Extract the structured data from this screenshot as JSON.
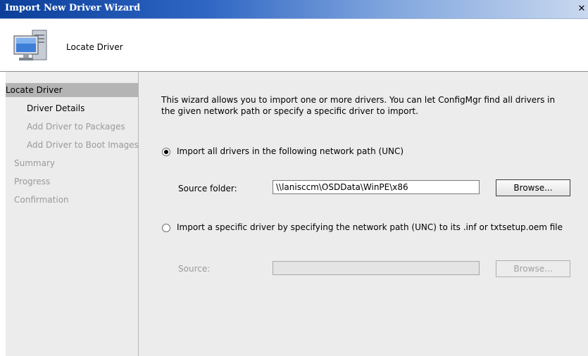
{
  "window": {
    "title": "Import New Driver Wizard",
    "close_glyph": "✕"
  },
  "header": {
    "title": "Locate Driver",
    "icon": "computer-icon"
  },
  "sidebar": {
    "items": [
      {
        "label": "Locate Driver",
        "state": "active"
      },
      {
        "label": "Driver Details",
        "state": "current"
      },
      {
        "label": "Add Driver to Packages",
        "state": "disabled"
      },
      {
        "label": "Add Driver to Boot Images",
        "state": "disabled"
      },
      {
        "label": "Summary",
        "state": "disabled"
      },
      {
        "label": "Progress",
        "state": "disabled"
      },
      {
        "label": "Confirmation",
        "state": "disabled"
      }
    ]
  },
  "main": {
    "description": "This wizard allows you to import one or more drivers. You can let ConfigMgr find all drivers in the given network path or specify a specific driver to import.",
    "option_all": {
      "label": "Import all drivers in the following network path (UNC)",
      "checked": true,
      "source_label": "Source folder:",
      "source_value": "\\\\lanisccm\\OSDData\\WinPE\\x86",
      "browse_label": "Browse..."
    },
    "option_specific": {
      "label": "Import a specific driver by specifying the network path (UNC) to its .inf or txtsetup.oem file",
      "checked": false,
      "source_label": "Source:",
      "source_value": "",
      "browse_label": "Browse..."
    }
  },
  "colors": {
    "titlebar_start": "#0b3f9a",
    "titlebar_end": "#c9d8ef",
    "panel_bg": "#ececec",
    "nav_active_bg": "#b4b4b4",
    "disabled_text": "#9a9a9a"
  }
}
